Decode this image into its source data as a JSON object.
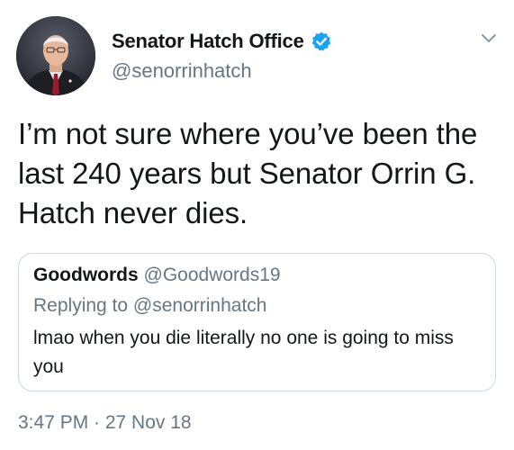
{
  "tweet": {
    "author": {
      "display_name": "Senator Hatch Office",
      "handle": "@senorrinhatch",
      "verified": true,
      "avatar": "senator-portrait-avatar"
    },
    "text": "I’m not sure where you’ve been the last 240 years but Senator Orrin G. Hatch never dies.",
    "menu_icon": "chevron-down-icon",
    "quoted_tweet": {
      "author_name": "Goodwords",
      "author_handle": "@Goodwords19",
      "reply_context": "Replying to @senorrinhatch",
      "text": "lmao when you die literally no one is going to miss you"
    },
    "timestamp": "3:47 PM · 27 Nov 18"
  },
  "colors": {
    "primary_text": "#14171a",
    "secondary_text": "#657786",
    "verified_blue": "#1da1f2",
    "border": "#ccd6dd"
  }
}
